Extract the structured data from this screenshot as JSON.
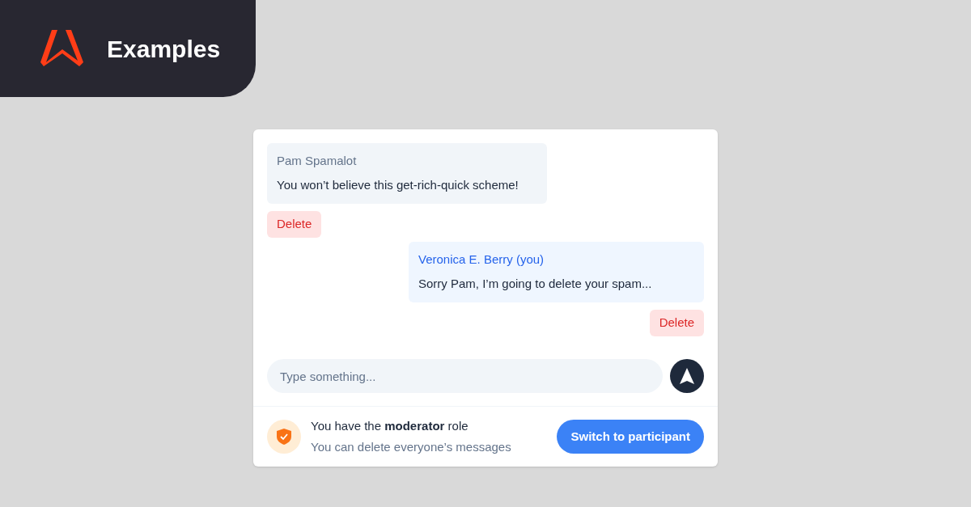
{
  "header": {
    "title": "Examples"
  },
  "messages": [
    {
      "author": "Pam Spamalot",
      "text": "You won’t believe this get-rich-quick scheme!",
      "own": false,
      "action": "Delete"
    },
    {
      "author": "Veronica E. Berry (you)",
      "text": "Sorry Pam, I’m going to delete your spam...",
      "own": true,
      "action": "Delete"
    }
  ],
  "composer": {
    "placeholder": "Type something..."
  },
  "role_bar": {
    "title": "You have the **moderator** role",
    "subtitle": "You can delete everyone’s messages",
    "button": "Switch to participant"
  }
}
